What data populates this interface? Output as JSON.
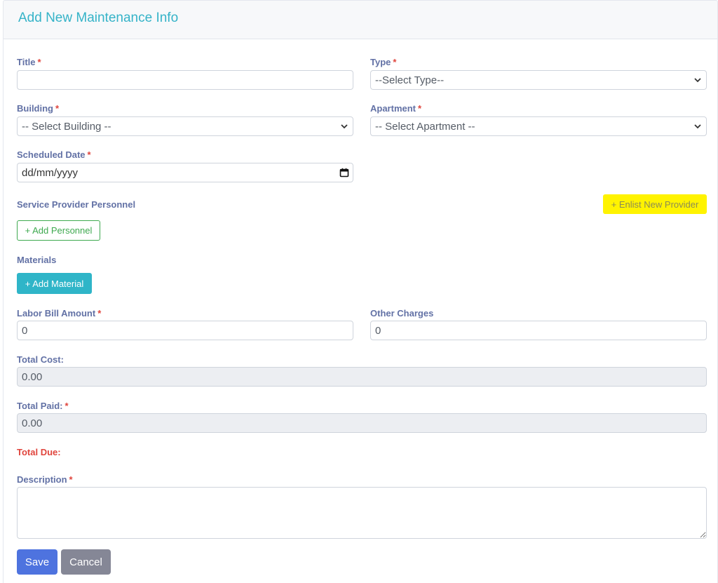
{
  "header": {
    "title": "Add New Maintenance Info"
  },
  "fields": {
    "title_label": "Title",
    "title_value": "",
    "type_label": "Type",
    "type_value": "--Select Type--",
    "building_label": "Building",
    "building_value": "-- Select Building --",
    "apartment_label": "Apartment",
    "apartment_value": "-- Select Apartment --",
    "scheduled_date_label": "Scheduled Date",
    "scheduled_date_value": "dd/mm/yyyy",
    "service_provider_label": "Service Provider Personnel",
    "materials_label": "Materials",
    "labor_bill_label": "Labor Bill Amount",
    "labor_bill_value": "0",
    "other_charges_label": "Other Charges",
    "other_charges_value": "0",
    "total_cost_label": "Total Cost:",
    "total_cost_value": "0.00",
    "total_paid_label": "Total Paid:",
    "total_paid_value": "0.00",
    "total_due_label": "Total Due:",
    "description_label": "Description",
    "required_mark": "*"
  },
  "buttons": {
    "enlist_provider": "+ Enlist New Provider",
    "add_personnel": "+ Add Personnel",
    "add_material": "+ Add Material",
    "save": "Save",
    "cancel": "Cancel"
  },
  "colors": {
    "title": "#35b3c8",
    "label": "#6271a5",
    "required": "#e0453d",
    "enlist_button": "#fff300",
    "add_personnel_border": "#3ea94f",
    "add_material_button": "#2fb5c8",
    "save_button": "#4e73df",
    "cancel_button": "#858796"
  }
}
